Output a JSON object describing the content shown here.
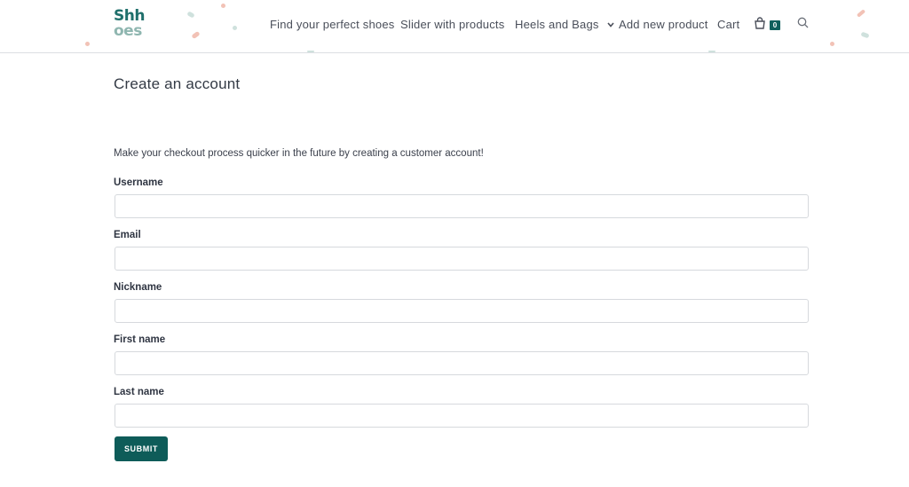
{
  "brand": {
    "logo_line1": "Shh",
    "logo_line2": "oes"
  },
  "nav": {
    "items": [
      {
        "label": "Find your perfect shoes"
      },
      {
        "label": "Slider with products"
      },
      {
        "label": "Heels and Bags"
      },
      {
        "label": "Add new product"
      },
      {
        "label": "Cart"
      }
    ],
    "cart_count": "0"
  },
  "page": {
    "title": "Create an account",
    "intro": "Make your checkout process quicker in the future by creating a customer account!"
  },
  "form": {
    "fields": [
      {
        "label": "Username",
        "value": ""
      },
      {
        "label": "Email",
        "value": ""
      },
      {
        "label": "Nickname",
        "value": ""
      },
      {
        "label": "First name",
        "value": ""
      },
      {
        "label": "Last name",
        "value": ""
      }
    ],
    "submit_label": "SUBMIT"
  },
  "colors": {
    "accent": "#0e5c59",
    "logo_dark": "#1f6f6b",
    "logo_light": "#8fb6b0",
    "confetti_pink": "#f2c2b6",
    "confetti_teal": "#cfe1dd"
  },
  "icons": {
    "cart": "shopping-bag-icon",
    "search": "search-icon",
    "dropdown": "chevron-down-icon"
  }
}
